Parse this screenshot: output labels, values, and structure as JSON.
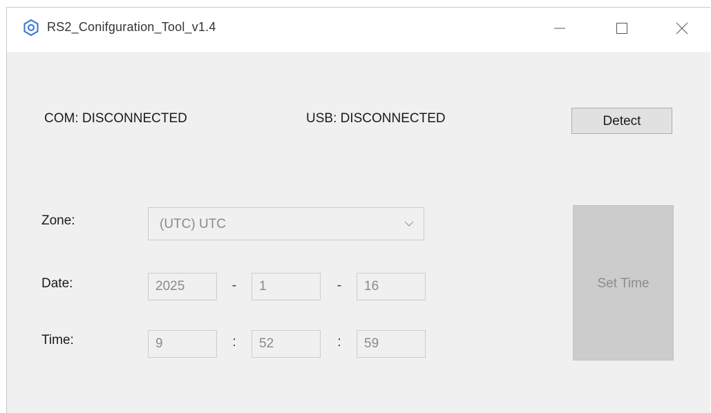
{
  "window": {
    "title": "RS2_Conifguration_Tool_v1.4",
    "controls": [
      "minimize-icon",
      "maximize-icon",
      "close-icon"
    ]
  },
  "status": {
    "com": "COM: DISCONNECTED",
    "usb": "USB: DISCONNECTED"
  },
  "buttons": {
    "detect": "Detect",
    "set_time": "Set Time"
  },
  "form": {
    "zone_label": "Zone:",
    "zone_value": "(UTC) UTC",
    "date_label": "Date:",
    "date_year": "2025",
    "date_month": "1",
    "date_day": "16",
    "date_sep": "-",
    "time_label": "Time:",
    "time_hour": "9",
    "time_minute": "52",
    "time_second": "59",
    "time_sep": ":"
  },
  "colors": {
    "accent": "#3b7dd8",
    "window_bg": "#f0f0f0",
    "disabled_text": "#8a8a8a"
  }
}
